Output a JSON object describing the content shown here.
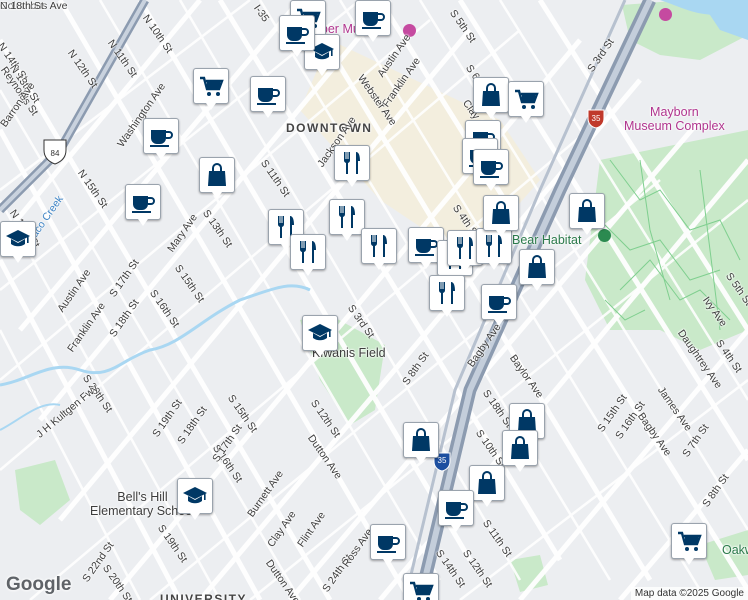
{
  "map": {
    "attribution": "Map data ©2025 Google",
    "logo": "Google",
    "colors": {
      "background": "#eceef1",
      "street": "#ffffff",
      "highway": "#8c9bb0",
      "park": "#c9e9c9",
      "water": "#a9d7f2",
      "marker_icon": "#003865",
      "poi_purple": "#b0348e",
      "poi_green": "#2b7a4b"
    }
  },
  "area_labels": [
    {
      "id": "downtown",
      "text": "DOWNTOWN"
    },
    {
      "id": "university",
      "text": "UNIVERSITY"
    }
  ],
  "poi_labels": [
    {
      "id": "dr-pepper",
      "text": "Dr Pepper Museum",
      "kind": "purple"
    },
    {
      "id": "mayborn",
      "text": "Mayborn\nMuseum Complex",
      "kind": "purple"
    },
    {
      "id": "bear-habitat",
      "text": "Bear Habitat",
      "kind": "green"
    },
    {
      "id": "kiwanis",
      "text": "Kiwanis Field",
      "kind": "dark"
    },
    {
      "id": "bells-hill",
      "text": "Bell's Hill\nElementary School",
      "kind": "dark"
    },
    {
      "id": "oakwood",
      "text": "Oakw",
      "kind": "green"
    }
  ],
  "street_labels": [
    "N 14th St",
    "N 13th St",
    "N 12th St",
    "N 11th St",
    "N 10th St",
    "Reynolds St",
    "Barron Ave",
    "N 15th St",
    "N 17th St",
    "Washington Ave",
    "Austin Ave",
    "Franklin Ave",
    "Mary Ave",
    "S 13th St",
    "S 11th St",
    "S 15th St",
    "S 16th St",
    "S 17th St",
    "S 18th St",
    "S 20th St",
    "Austin Ave",
    "Franklin Ave",
    "Jackson Ave",
    "Webster Ave",
    "Clay Ave",
    "S 6th St",
    "S 5th St",
    "S 4th St",
    "S 3rd St",
    "S 8th St",
    "S 12th St",
    "Dutton Ave",
    "S 15th St",
    "S 16th St",
    "S 17th St",
    "S 18th St",
    "S 19th St",
    "Burnett Ave",
    "Clay Ave",
    "Flint Ave",
    "Dutton Ave",
    "S 19th St",
    "S 20th St",
    "S 22nd St",
    "S 24th St",
    "Ross Ave",
    "Baylor Ave",
    "S 18th St",
    "S 10th St",
    "S 11th St",
    "S 12th St",
    "S 14th St",
    "S 15th St",
    "S 16th St",
    "James Ave",
    "Bagby Ave",
    "S 7th St",
    "S 8th St",
    "Daughtrey Ave",
    "Ivy Ave",
    "S 5th St",
    "S 4th St",
    "S 3rd St",
    "Bagby Ave",
    "J H Kultgen Fwy",
    "I-35",
    "Waco Creek",
    "Columbus Ave",
    "N 18th St"
  ],
  "highway_shields": [
    "84",
    "35",
    "35"
  ],
  "markers": [
    {
      "id": "m1",
      "icon": "shopping-cart-icon"
    },
    {
      "id": "m2",
      "icon": "graduation-cap-icon"
    },
    {
      "id": "m3",
      "icon": "shopping-cart-icon"
    },
    {
      "id": "m4",
      "icon": "coffee-cup-icon"
    },
    {
      "id": "m5",
      "icon": "coffee-cup-icon"
    },
    {
      "id": "m6",
      "icon": "shopping-bag-icon"
    },
    {
      "id": "m7",
      "icon": "coffee-cup-icon"
    },
    {
      "id": "m8",
      "icon": "graduation-cap-icon"
    },
    {
      "id": "m9",
      "icon": "restaurant-icon"
    },
    {
      "id": "m10",
      "icon": "restaurant-icon"
    },
    {
      "id": "m11",
      "icon": "restaurant-icon"
    },
    {
      "id": "m12",
      "icon": "restaurant-icon"
    },
    {
      "id": "m13",
      "icon": "restaurant-icon"
    },
    {
      "id": "m14",
      "icon": "coffee-cup-icon"
    },
    {
      "id": "m15",
      "icon": "restaurant-icon"
    },
    {
      "id": "m16",
      "icon": "restaurant-icon"
    },
    {
      "id": "m17",
      "icon": "restaurant-icon"
    },
    {
      "id": "m18",
      "icon": "restaurant-icon"
    },
    {
      "id": "m19",
      "icon": "coffee-cup-icon"
    },
    {
      "id": "m20",
      "icon": "shopping-bag-icon"
    },
    {
      "id": "m21",
      "icon": "shopping-cart-icon"
    },
    {
      "id": "m22",
      "icon": "coffee-cup-icon"
    },
    {
      "id": "m23",
      "icon": "coffee-cup-icon"
    },
    {
      "id": "m24",
      "icon": "coffee-cup-icon"
    },
    {
      "id": "m25",
      "icon": "shopping-bag-icon"
    },
    {
      "id": "m26",
      "icon": "shopping-bag-icon"
    },
    {
      "id": "m27",
      "icon": "graduation-cap-icon"
    },
    {
      "id": "m28",
      "icon": "shopping-bag-icon"
    },
    {
      "id": "m29",
      "icon": "shopping-bag-icon"
    },
    {
      "id": "m30",
      "icon": "shopping-bag-icon"
    },
    {
      "id": "m31",
      "icon": "graduation-cap-icon"
    },
    {
      "id": "m32",
      "icon": "shopping-bag-icon"
    },
    {
      "id": "m33",
      "icon": "shopping-bag-icon"
    },
    {
      "id": "m34",
      "icon": "coffee-cup-icon"
    },
    {
      "id": "m35",
      "icon": "coffee-cup-icon"
    },
    {
      "id": "m36",
      "icon": "shopping-cart-icon"
    },
    {
      "id": "m37",
      "icon": "shopping-cart-icon"
    },
    {
      "id": "m38",
      "icon": "coffee-cup-icon"
    },
    {
      "id": "m39",
      "icon": "coffee-cup-icon"
    }
  ]
}
